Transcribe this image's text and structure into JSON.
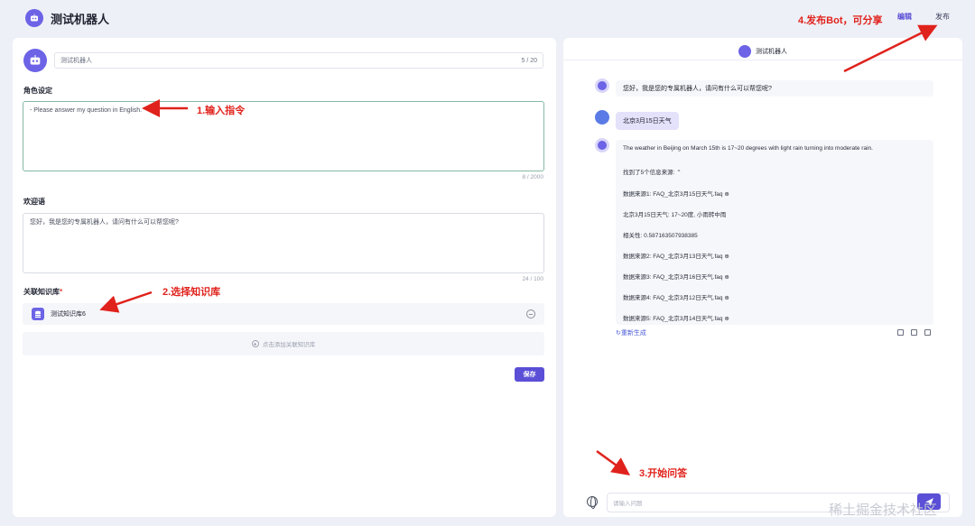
{
  "header": {
    "title": "测试机器人",
    "edit_label": "编辑",
    "publish_label": "发布"
  },
  "left": {
    "bot_name_value": "测试机器人",
    "bot_name_count": "5 / 20",
    "role_label": "角色设定",
    "role_value": "- Please answer my question in English.",
    "role_count": "8 / 2000",
    "welcome_label": "欢迎语",
    "welcome_value": "您好，我是您的专属机器人，请问有什么可以帮您呢?",
    "welcome_count": "24 / 100",
    "kb_label": "关联知识库",
    "kb_required": "*",
    "kb_item": "测试知识库6",
    "kb_add_label": "点击添加关联知识库",
    "save_label": "保存"
  },
  "chat": {
    "title": "测试机器人",
    "welcome": "您好，我是您的专属机器人，请问有什么可以帮您呢?",
    "user_msg": "北京3月15日天气",
    "answer": "The weather in Beijing on March 15th is 17~20 degrees with light rain turning into moderate rain.",
    "sources_header": "找到了5个信息来源:",
    "source_lines": [
      "数据来源1:  FAQ_北京3月15日天气.faq",
      "北京3月15日天气:  17~20度, 小雨转中雨",
      "相关性:  0.587163507938385",
      "数据来源2:  FAQ_北京3月13日天气.faq",
      "数据来源3:  FAQ_北京3月16日天气.faq",
      "数据来源4:  FAQ_北京3月12日天气.faq",
      "数据来源5:  FAQ_北京3月14日天气.faq"
    ],
    "regenerate_label": "重新生成",
    "input_placeholder": "请输入问题"
  },
  "annotations": {
    "step1": "1.输入指令",
    "step2": "2.选择知识库",
    "step3": "3.开始问答",
    "step4": "4.发布Bot，可分享"
  },
  "watermark": "稀土掘金技术社区",
  "colors": {
    "accent": "#5a4fd6",
    "annotation": "#e0221c",
    "background": "#eef0f7"
  }
}
